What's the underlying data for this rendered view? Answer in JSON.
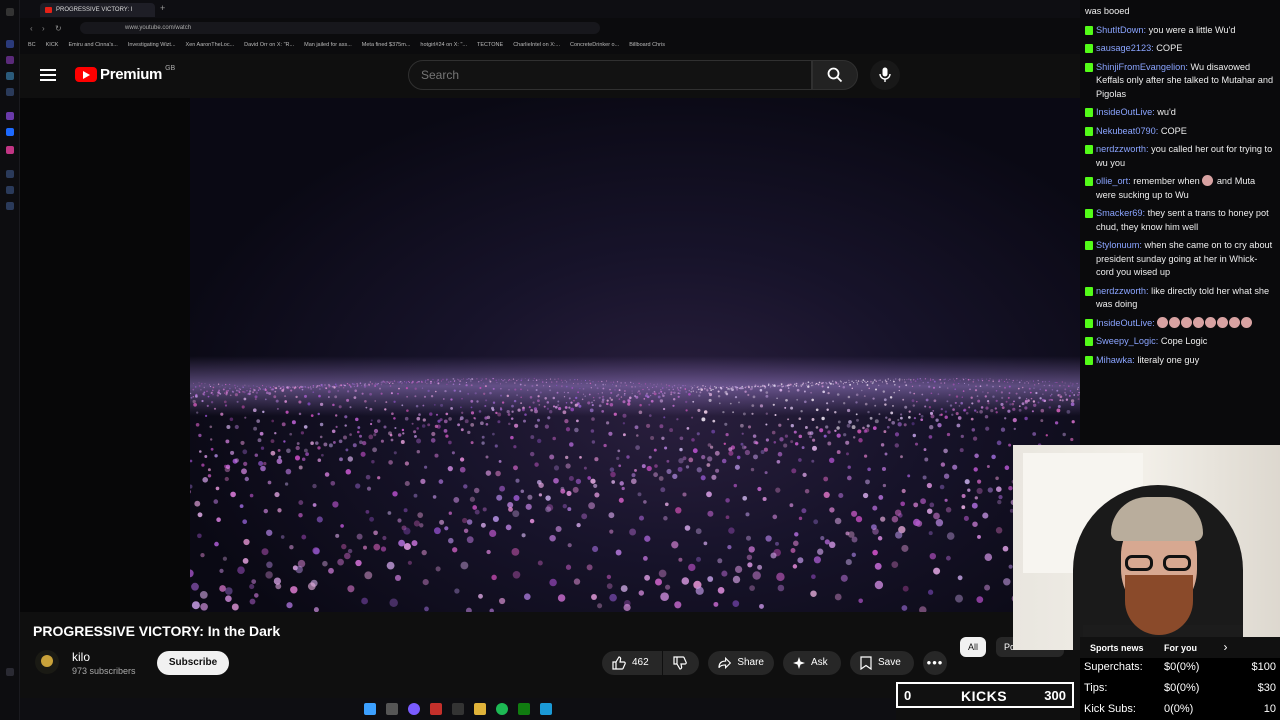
{
  "browser": {
    "tab_title": "PROGRESSIVE VICTORY: I",
    "new_tab": "+",
    "url": "www.youtube.com/watch",
    "bookmarks": [
      "BC",
      "KICK",
      "Emiru and Cinna's...",
      "Investigating Wizt...",
      "Xen AaronTheLoc...",
      "David Orr on X: \"R...",
      "Man jailed for ass...",
      "Meta fined $375m...",
      "hotgirl#24 on X: \"...",
      "TECTONE",
      "CharlieIntel on X:...",
      "ConcreteDrinker o...",
      "Billboard Chris"
    ]
  },
  "youtube": {
    "brand": "Premium",
    "region": "GB",
    "search_placeholder": "Search",
    "video_title": "PROGRESSIVE VICTORY: In the Dark",
    "channel_name": "kilo",
    "subscribers": "973 subscribers",
    "subscribe_label": "Subscribe",
    "like_count": "462",
    "share_label": "Share",
    "ask_label": "Ask",
    "save_label": "Save",
    "chips": [
      "All",
      "Politics news",
      "Sports news",
      "For you"
    ]
  },
  "chat": {
    "messages": [
      {
        "user": "",
        "text": "was booed"
      },
      {
        "user": "ShutItDown:",
        "text": "you were a little Wu'd"
      },
      {
        "user": "sausage2123:",
        "text": "COPE"
      },
      {
        "user": "ShinjiFromEvangelion:",
        "text": "Wu disavowed Keffals only after she talked to Mutahar and Pigolas"
      },
      {
        "user": "InsideOutLive:",
        "text": "wu'd"
      },
      {
        "user": "Nekubeat0790:",
        "text": "COPE"
      },
      {
        "user": "nerdzzworth:",
        "text": "you called her out for trying to wu you"
      },
      {
        "user": "ollie_ort:",
        "text": "remember when",
        "emote": true,
        "text2": "and Muta were sucking up to Wu"
      },
      {
        "user": "Smacker69:",
        "text": "they sent a trans to honey pot chud, they know him well"
      },
      {
        "user": "Stylonuum:",
        "text": "when she came on to cry about president sunday going at her in Whick-cord you wised up"
      },
      {
        "user": "nerdzzworth:",
        "text": "like directly told her what she was doing"
      },
      {
        "user": "InsideOutLive:",
        "text": "",
        "emote_row": 8
      },
      {
        "user": "Sweepy_Logic:",
        "text": "Cope Logic"
      },
      {
        "user": "Mihawka:",
        "text": "literaly one guy"
      }
    ]
  },
  "stream_overlay": {
    "superchats_label": "Superchats:",
    "superchats_value": "$0(0%)",
    "superchats_goal": "$100",
    "tips_label": "Tips:",
    "tips_value": "$0(0%)",
    "tips_goal": "$30",
    "kick_subs_label": "Kick Subs:",
    "kick_subs_value": "0(0%)",
    "kick_subs_goal": "10",
    "kicks_current": "0",
    "kicks_label": "KICKS",
    "kicks_goal": "300"
  },
  "colors": {
    "chat_user": "#8aa4ff",
    "kick_green": "#53fc18",
    "yt_red": "#ff0000"
  }
}
